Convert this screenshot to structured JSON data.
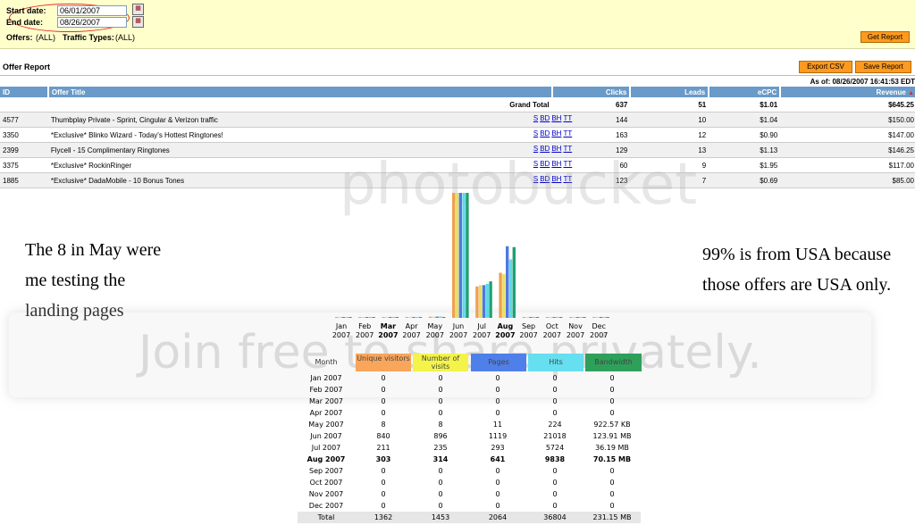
{
  "filters": {
    "start_label": "Start date:",
    "start_value": "06/01/2007",
    "end_label": "End date:",
    "end_value": "08/26/2007",
    "offers_label": "Offers:",
    "offers_value": "(ALL)",
    "traffic_label": "Traffic Types:",
    "traffic_value": "(ALL)",
    "get_report": "Get Report"
  },
  "report": {
    "title": "Offer Report",
    "export_csv": "Export CSV",
    "save_report": "Save Report",
    "as_of": "As of: 08/26/2007 16:41:53 EDT",
    "columns": [
      "ID",
      "Offer Title",
      "Clicks",
      "Leads",
      "eCPC",
      "Revenue"
    ],
    "grand_total": {
      "label": "Grand Total",
      "clicks": "637",
      "leads": "51",
      "ecpc": "$1.01",
      "revenue": "$645.25"
    },
    "rows": [
      {
        "id": "4577",
        "title": "Thumbplay Private - Sprint, Cingular & Verizon traffic",
        "clicks": "144",
        "leads": "10",
        "ecpc": "$1.04",
        "revenue": "$150.00"
      },
      {
        "id": "3350",
        "title": "*Exclusive* Blinko Wizard - Today's Hottest Ringtones!",
        "clicks": "163",
        "leads": "12",
        "ecpc": "$0.90",
        "revenue": "$147.00"
      },
      {
        "id": "2399",
        "title": "Flycell - 15 Complimentary Ringtones",
        "clicks": "129",
        "leads": "13",
        "ecpc": "$1.13",
        "revenue": "$146.25"
      },
      {
        "id": "3375",
        "title": "*Exclusive* RockinRinger",
        "clicks": "60",
        "leads": "9",
        "ecpc": "$1.95",
        "revenue": "$117.00"
      },
      {
        "id": "1885",
        "title": "*Exclusive* DadaMobile - 10 Bonus Tones",
        "clicks": "123",
        "leads": "7",
        "ecpc": "$0.69",
        "revenue": "$85.00"
      }
    ],
    "links": [
      "S",
      "BD",
      "BH",
      "TT"
    ]
  },
  "notes": {
    "left_line1": "The 8 in May were",
    "left_line2": "me testing the",
    "left_line3": "landing pages",
    "right_line1": "99% is from USA because",
    "right_line2": "those offers are USA only."
  },
  "watermark": {
    "line1": "photobucket",
    "line2": "Join free to share privately."
  },
  "stats": {
    "headers": [
      "Month",
      "Unique visitors",
      "Number of visits",
      "Pages",
      "Hits",
      "Bandwidth"
    ],
    "header_colors": [
      "#ffffff",
      "#f9a55a",
      "#f3f34a",
      "#4f7fe8",
      "#66dff0",
      "#2fa05a"
    ],
    "rows": [
      {
        "month": "Jan 2007",
        "uv": "0",
        "visits": "0",
        "pages": "0",
        "hits": "0",
        "bw": "0"
      },
      {
        "month": "Feb 2007",
        "uv": "0",
        "visits": "0",
        "pages": "0",
        "hits": "0",
        "bw": "0"
      },
      {
        "month": "Mar 2007",
        "uv": "0",
        "visits": "0",
        "pages": "0",
        "hits": "0",
        "bw": "0"
      },
      {
        "month": "Apr 2007",
        "uv": "0",
        "visits": "0",
        "pages": "0",
        "hits": "0",
        "bw": "0"
      },
      {
        "month": "May 2007",
        "uv": "8",
        "visits": "8",
        "pages": "11",
        "hits": "224",
        "bw": "922.57 KB"
      },
      {
        "month": "Jun 2007",
        "uv": "840",
        "visits": "896",
        "pages": "1119",
        "hits": "21018",
        "bw": "123.91 MB"
      },
      {
        "month": "Jul 2007",
        "uv": "211",
        "visits": "235",
        "pages": "293",
        "hits": "5724",
        "bw": "36.19 MB"
      },
      {
        "month": "Aug 2007",
        "uv": "303",
        "visits": "314",
        "pages": "641",
        "hits": "9838",
        "bw": "70.15 MB"
      },
      {
        "month": "Sep 2007",
        "uv": "0",
        "visits": "0",
        "pages": "0",
        "hits": "0",
        "bw": "0"
      },
      {
        "month": "Oct 2007",
        "uv": "0",
        "visits": "0",
        "pages": "0",
        "hits": "0",
        "bw": "0"
      },
      {
        "month": "Nov 2007",
        "uv": "0",
        "visits": "0",
        "pages": "0",
        "hits": "0",
        "bw": "0"
      },
      {
        "month": "Dec 2007",
        "uv": "0",
        "visits": "0",
        "pages": "0",
        "hits": "0",
        "bw": "0"
      }
    ],
    "total": {
      "month": "Total",
      "uv": "1362",
      "visits": "1453",
      "pages": "2064",
      "hits": "36804",
      "bw": "231.15 MB"
    }
  },
  "chart_data": {
    "type": "bar",
    "categories": [
      "Jan 2007",
      "Feb 2007",
      "Mar 2007",
      "Apr 2007",
      "May 2007",
      "Jun 2007",
      "Jul 2007",
      "Aug 2007",
      "Sep 2007",
      "Oct 2007",
      "Nov 2007",
      "Dec 2007"
    ],
    "category_lines": [
      [
        "Jan",
        "2007"
      ],
      [
        "Feb",
        "2007"
      ],
      [
        "Mar",
        "2007"
      ],
      [
        "Apr",
        "2007"
      ],
      [
        "May",
        "2007"
      ],
      [
        "Jun",
        "2007"
      ],
      [
        "Jul",
        "2007"
      ],
      [
        "Aug",
        "2007"
      ],
      [
        "Sep",
        "2007"
      ],
      [
        "Oct",
        "2007"
      ],
      [
        "Nov",
        "2007"
      ],
      [
        "Dec",
        "2007"
      ]
    ],
    "bold_categories": [
      "Mar 2007",
      "Aug 2007"
    ],
    "series": [
      {
        "name": "Unique visitors",
        "color": "#f0a050",
        "values": [
          0,
          0,
          0,
          0,
          8,
          840,
          211,
          303,
          0,
          0,
          0,
          0
        ]
      },
      {
        "name": "Number of visits",
        "color": "#e8e060",
        "values": [
          0,
          0,
          0,
          0,
          8,
          896,
          235,
          314,
          0,
          0,
          0,
          0
        ]
      },
      {
        "name": "Pages",
        "color": "#5078e0",
        "values": [
          0,
          0,
          0,
          0,
          11,
          1119,
          293,
          641,
          0,
          0,
          0,
          0
        ]
      },
      {
        "name": "Hits",
        "color": "#60d8e8",
        "values": [
          0,
          0,
          0,
          0,
          224,
          21018,
          5724,
          9838,
          0,
          0,
          0,
          0
        ]
      },
      {
        "name": "Bandwidth",
        "color": "#20a070",
        "values": [
          0,
          0,
          0,
          0,
          0.9,
          123.91,
          36.19,
          70.15,
          0,
          0,
          0,
          0
        ]
      }
    ]
  }
}
